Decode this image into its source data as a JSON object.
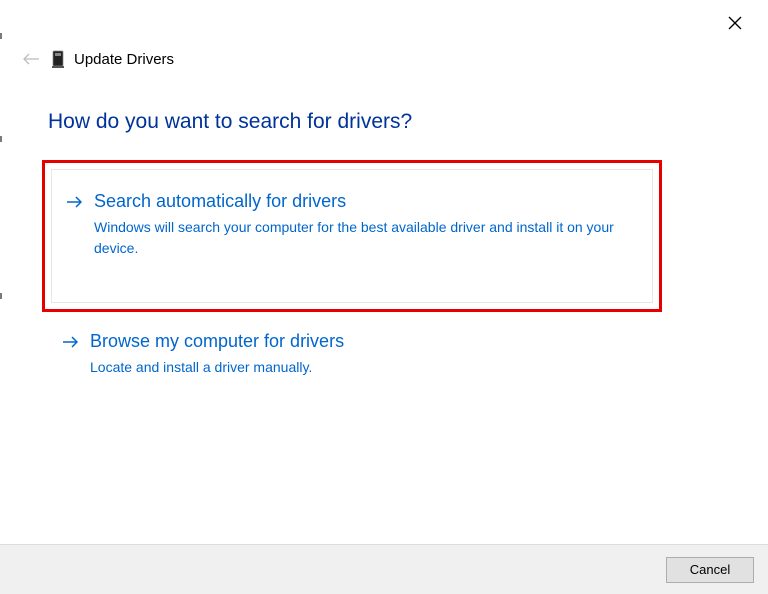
{
  "window": {
    "title": "Update Drivers"
  },
  "heading": "How do you want to search for drivers?",
  "options": {
    "auto": {
      "title": "Search automatically for drivers",
      "description": "Windows will search your computer for the best available driver and install it on your device."
    },
    "browse": {
      "title": "Browse my computer for drivers",
      "description": "Locate and install a driver manually."
    }
  },
  "footer": {
    "cancel": "Cancel"
  }
}
